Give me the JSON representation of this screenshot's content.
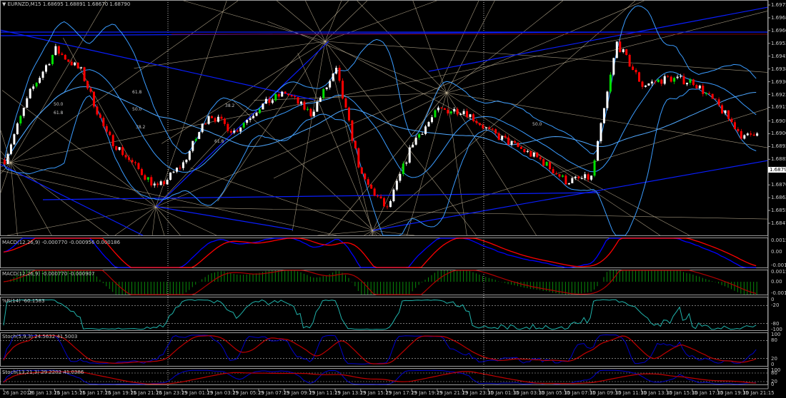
{
  "header": {
    "symbol_timeframe": "EURNZD,M15",
    "ohlc": "1.68695 1.68891 1.68670 1.68790",
    "menu_icon": "triangle-down-icon"
  },
  "price_axis": [
    "1.69755",
    "1.69680",
    "1.69605",
    "1.69530",
    "1.69455",
    "1.69380",
    "1.69305",
    "1.69230",
    "1.69155",
    "1.69075",
    "1.69000",
    "1.68925",
    "1.68850",
    "1.68700",
    "1.68625",
    "1.68550",
    "1.68475"
  ],
  "current_price": "1.68790",
  "time_axis": [
    "26 Jan 2018",
    "26 Jan 13:15",
    "26 Jan 15:15",
    "26 Jan 17:15",
    "26 Jan 19:15",
    "26 Jan 21:15",
    "26 Jan 23:15",
    "29 Jan 01:15",
    "29 Jan 03:15",
    "29 Jan 05:15",
    "29 Jan 07:15",
    "29 Jan 09:15",
    "29 Jan 11:15",
    "29 Jan 13:15",
    "29 Jan 15:15",
    "29 Jan 17:15",
    "29 Jan 19:15",
    "29 Jan 21:15",
    "29 Jan 23:15",
    "30 Jan 01:15",
    "30 Jan 03:15",
    "30 Jan 05:15",
    "30 Jan 07:15",
    "30 Jan 09:15",
    "30 Jan 11:15",
    "30 Jan 13:15",
    "30 Jan 15:15",
    "30 Jan 17:15",
    "30 Jan 19:15",
    "30 Jan 21:15"
  ],
  "fib_labels": [
    "61.8",
    "50.0",
    "38.2",
    "61.8",
    "50.0",
    "38.2",
    "61.8",
    "50.0"
  ],
  "indicators": [
    {
      "label": "MACD(12,26,9) -0.000770 -0.000956 0.000186",
      "axis": [
        "0.001565",
        "0.00",
        "-0.00178"
      ]
    },
    {
      "label": "MACD(12,26,9) -0.000770 -0.000907",
      "axis": [
        "0.001565",
        "0.00",
        "-0.00178"
      ]
    },
    {
      "label": "%R(14) -60.1583",
      "axis": [
        "0",
        "-20",
        "-80",
        "-100"
      ]
    },
    {
      "label": "Stoch(5,9,3) 24.5632 41.5003",
      "axis": [
        "100",
        "80",
        "20",
        "0"
      ]
    },
    {
      "label": "Stoch(13,21,3) 29.2202 41.0386",
      "axis": [
        "100",
        "80",
        "20",
        "0"
      ]
    }
  ],
  "colors": {
    "bull": "#ffffff",
    "bull_alt": "#00e000",
    "bear": "#ff0000",
    "bands": "#3a9cff",
    "trend": "#0a1eff",
    "fan": "#d8c8a8",
    "macd_main": "#0000ff",
    "macd_signal": "#ff0000",
    "wpr": "#20b2aa",
    "stoch_main": "#0000cc",
    "stoch_signal": "#c00000"
  },
  "chart_data": {
    "type": "candlestick",
    "title": "EURNZD,M15",
    "x_ticks": "time_axis",
    "ylim": [
      1.68475,
      1.69755
    ],
    "approx_close_at_ticks": [
      1.68847,
      1.69242,
      1.69493,
      1.69368,
      1.68993,
      1.68826,
      1.6868,
      1.68826,
      1.69118,
      1.69013,
      1.69159,
      1.69242,
      1.69118,
      1.69368,
      1.68743,
      1.68555,
      1.68951,
      1.69138,
      1.69138,
      1.69013,
      1.6893,
      1.68847,
      1.68722,
      1.68743,
      1.69534,
      1.69284,
      1.69326,
      1.69305,
      1.69159,
      1.68972
    ],
    "last_close": 1.6907
  }
}
